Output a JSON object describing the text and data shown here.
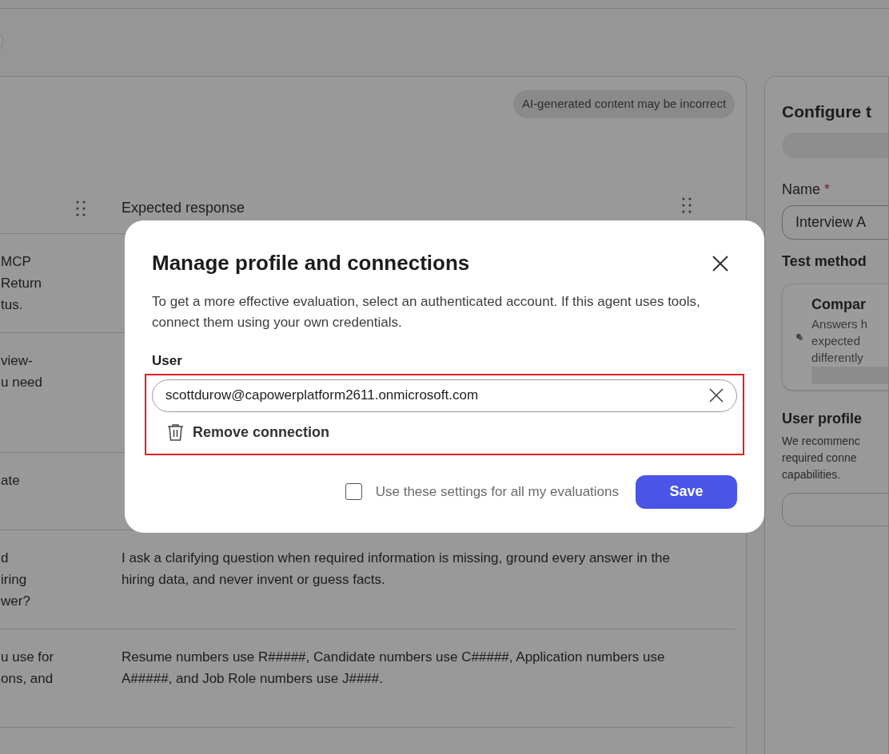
{
  "notice": "AI-generated content may be incorrect",
  "table": {
    "columns": [
      {},
      {
        "label": "Expected response"
      }
    ],
    "rows": [
      {
        "column_1": "MCP\nReturn\ntus."
      },
      {
        "column_1": "view-\nu need"
      },
      {
        "column_1": "ate"
      },
      {
        "column_1": "d\niring\nwer?",
        "expected_response": "I ask a clarifying question when required information is missing, ground every answer in the hiring data, and never invent or guess facts."
      },
      {
        "column_1": "u use for\nons, and",
        "expected_response": "Resume numbers use R#####, Candidate numbers use C#####, Application numbers use A#####, and Job Role numbers use J####."
      }
    ]
  },
  "config_panel": {
    "title": "Configure t",
    "name_label": "Name",
    "required_mark": "*",
    "name_value": "Interview A",
    "test_method_label": "Test method",
    "method_card": {
      "title": "Compar",
      "description": "Answers h\nexpected\ndifferently"
    },
    "user_profile_label": "User profile",
    "user_profile_text": "We recommenc\nrequired conne\ncapabilities."
  },
  "dialog": {
    "title": "Manage profile and connections",
    "description": "To get a more effective evaluation, select an authenticated account. If this agent uses tools, connect them using your own credentials.",
    "user_label": "User",
    "user_value": "scottdurow@capowerplatform2611.onmicrosoft.com",
    "remove_label": "Remove connection",
    "checkbox": {
      "label": "Use these settings for all my evaluations",
      "checked": false
    },
    "save_label": "Save"
  }
}
